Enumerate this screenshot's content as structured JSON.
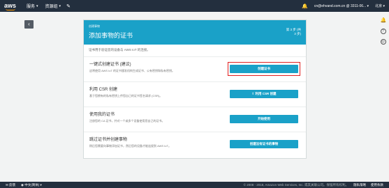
{
  "nav": {
    "brand": "aws",
    "services": "服务",
    "resource_groups": "资源组",
    "account": "cn@ehvand.com.cn @ 3311-06...",
    "region": "北京"
  },
  "rail": {
    "icons": [
      "bell-icon",
      "help-icon",
      "globe-icon"
    ]
  },
  "card": {
    "breadcrumb": "创建事物",
    "title": "添加事物的证书",
    "step": "第 3 步 (共 3 步)",
    "intro": "证书用于验证您的设备与 AWS IoT 的连接。",
    "options": [
      {
        "title": "一键式创建证书 (建议)",
        "desc": "这将使用 AWS IoT 的证书颁发机构生成证书、公有密钥和私有密钥。",
        "button": "创建证书"
      },
      {
        "title": "利用 CSR 创建",
        "desc": "基于您拥有的私有密钥上传您自己的证书签名请求 (CSR)。",
        "button": "利用 CSR 创建"
      },
      {
        "title": "使用我的证书",
        "desc": "注册您的 CA 证书，并对一个或多个设备使用您自己的证书。",
        "button": "开始使用"
      },
      {
        "title": "跳过证书并创建事物",
        "desc": "稍后您需要向事物添加证书，然后您的设备才能连接到 AWS IoT。",
        "button": "创建没有证书的事物"
      }
    ]
  },
  "footer": {
    "feedback": "反馈",
    "language": "中文(简体)",
    "copyright": "© 2008 - 2018, Amazon Web Services, Inc. 或其关联公司。保留所有权利。",
    "privacy": "隐私策略",
    "terms": "使用条款"
  },
  "colors": {
    "nav_bg": "#232f3e",
    "accent": "#1aa1c8",
    "highlight": "#e02020",
    "orange": "#ff9900"
  }
}
